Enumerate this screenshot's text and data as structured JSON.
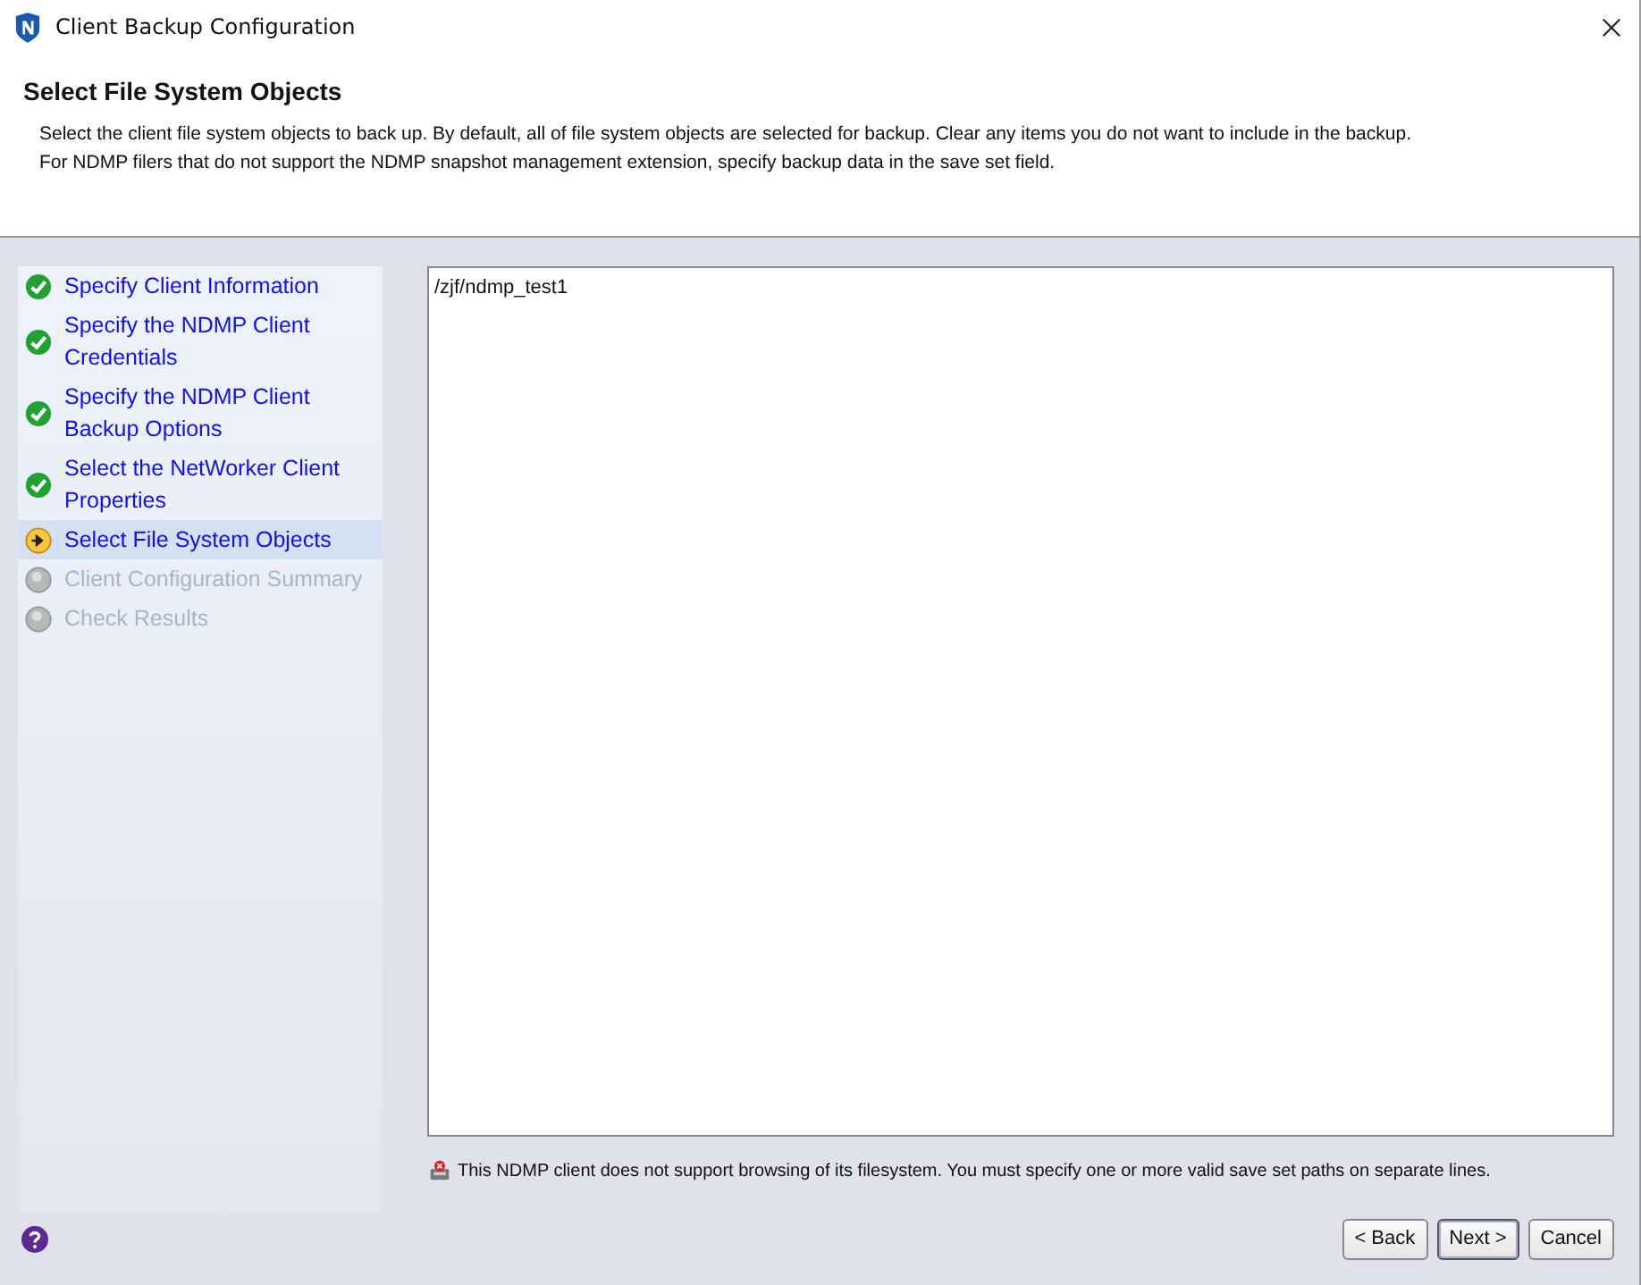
{
  "window": {
    "title": "Client Backup Configuration"
  },
  "header": {
    "title": "Select File System Objects",
    "description": [
      "Select the client file system objects to back up. By default, all of file system objects are selected for backup. Clear any items you do not want to include in the backup.",
      "For NDMP filers that do not support the NDMP snapshot management extension, specify backup data in the save set field."
    ]
  },
  "steps": [
    {
      "label": "Specify Client Information",
      "kind": "done",
      "selected": false
    },
    {
      "label": "Specify the NDMP Client Credentials",
      "kind": "done",
      "selected": false
    },
    {
      "label": "Specify the NDMP Client Backup Options",
      "kind": "done",
      "selected": false
    },
    {
      "label": "Select the NetWorker Client Properties",
      "kind": "done",
      "selected": false
    },
    {
      "label": "Select File System Objects",
      "kind": "current",
      "selected": true
    },
    {
      "label": "Client Configuration Summary",
      "kind": "pending",
      "selected": false
    },
    {
      "label": "Check Results",
      "kind": "pending",
      "selected": false
    }
  ],
  "save_set": {
    "value": "/zjf/ndmp_test1"
  },
  "warning": "This NDMP client does not support browsing of its filesystem. You must specify one or more valid save set paths on separate lines.",
  "buttons": [
    "< Back",
    "Next >",
    "Cancel"
  ]
}
